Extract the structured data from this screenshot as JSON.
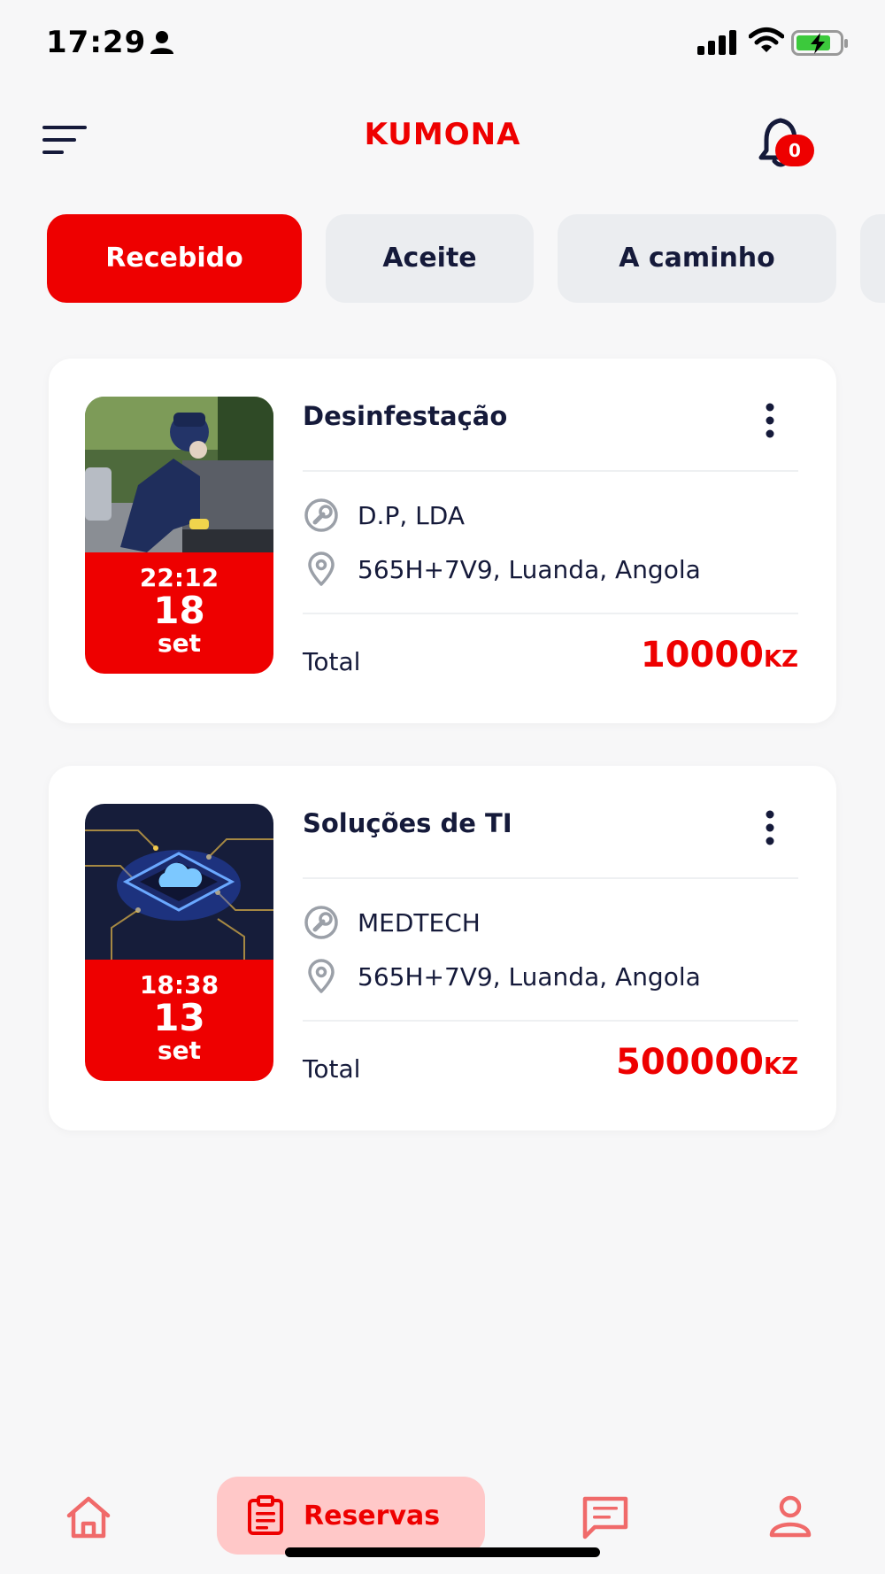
{
  "status_bar": {
    "time": "17:29",
    "icons": [
      "person-icon",
      "cellular-signal-icon",
      "wifi-icon",
      "battery-charging-icon"
    ]
  },
  "header": {
    "title": "KUMONA",
    "notification_count": "0"
  },
  "tabs": [
    {
      "label": "Recebido",
      "active": true
    },
    {
      "label": "Aceite",
      "active": false
    },
    {
      "label": "A caminho",
      "active": false
    }
  ],
  "bookings": [
    {
      "title": "Desinfestação",
      "provider": "D.P, LDA",
      "address": "565H+7V9, Luanda, Angola",
      "time": "22:12",
      "day": "18",
      "month": "set",
      "total_label": "Total",
      "total_value": "10000",
      "currency": "KZ"
    },
    {
      "title": "Soluções de TI",
      "provider": "MEDTECH",
      "address": "565H+7V9, Luanda, Angola",
      "time": "18:38",
      "day": "13",
      "month": "set",
      "total_label": "Total",
      "total_value": "500000",
      "currency": "KZ"
    }
  ],
  "bottom_nav": {
    "reservas_label": "Reservas"
  },
  "colors": {
    "accent": "#ee0000",
    "text_dark": "#151a3a",
    "tab_inactive": "#ebedf0",
    "nav_active_bg": "#ffc8c8",
    "background": "#f7f7f8"
  }
}
